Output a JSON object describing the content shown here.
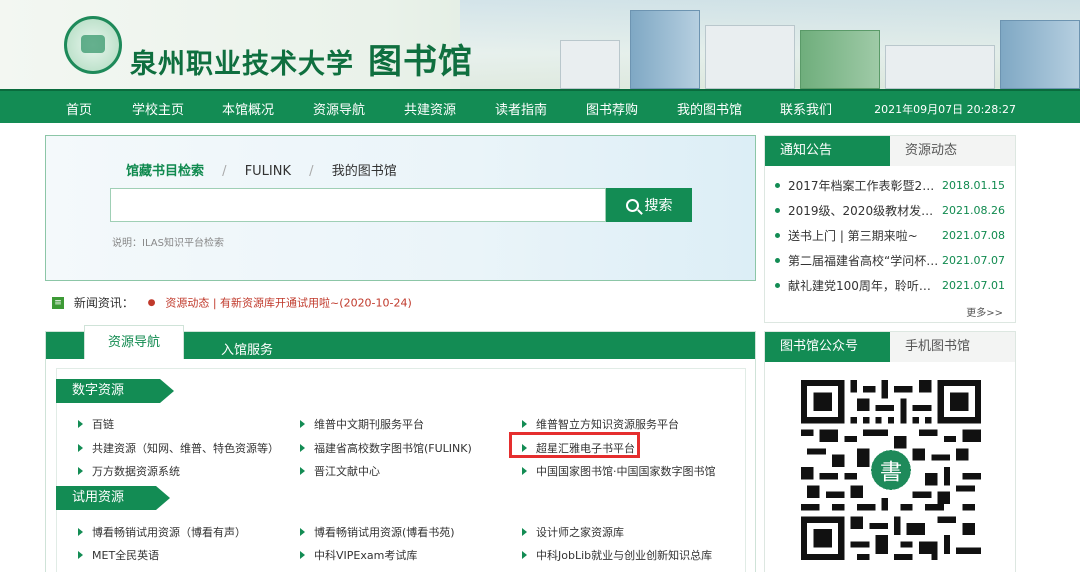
{
  "header": {
    "site_name": "泉州职业技术大学",
    "library_name": "图书馆"
  },
  "nav": {
    "items": [
      "首页",
      "学校主页",
      "本馆概况",
      "资源导航",
      "共建资源",
      "读者指南",
      "图书荐购",
      "我的图书馆",
      "联系我们"
    ],
    "datetime": "2021年09月07日 20:28:27"
  },
  "search": {
    "tabs": [
      "馆藏书目检索",
      "FULINK",
      "我的图书馆"
    ],
    "input_value": "",
    "button_label": "搜索",
    "note": "说明：ILAS知识平台检索"
  },
  "news": {
    "label": "新闻资讯：",
    "item": "资源动态 | 有新资源库开通试用啦~(2020-10-24)"
  },
  "resources": {
    "tabs": [
      "资源导航",
      "入馆服务"
    ],
    "sections": [
      {
        "title": "数字资源",
        "items": [
          "百链",
          "维普中文期刊服务平台",
          "维普智立方知识资源服务平台",
          "共建资源（知网、维普、特色资源等）",
          "福建省高校数字图书馆(FULINK)",
          "超星汇雅电子书平台",
          "万方数据资源系统",
          "晋江文献中心",
          "中国国家图书馆·中国国家数字图书馆"
        ]
      },
      {
        "title": "试用资源",
        "items": [
          "博看畅销试用资源（博看有声）",
          "博看畅销试用资源(博看书苑)",
          "设计师之家资源库",
          "MET全民英语",
          "中科VIPExam考试库",
          "中科JobLib就业与创业创新知识总库"
        ]
      }
    ]
  },
  "notice": {
    "tabs": [
      "通知公告",
      "资源动态"
    ],
    "items": [
      {
        "title": "2017年档案工作表彰暨201…",
        "date": "2018.01.15"
      },
      {
        "title": "2019级、2020级教材发放…",
        "date": "2021.08.26"
      },
      {
        "title": "送书上门 | 第三期来啦~",
        "date": "2021.07.08"
      },
      {
        "title": "第二届福建省高校“学问杯…",
        "date": "2021.07.07"
      },
      {
        "title": "献礼建党100周年，聆听红…",
        "date": "2021.07.01"
      }
    ],
    "more": "更多>>"
  },
  "wechat": {
    "tabs": [
      "图书馆公众号",
      "手机图书馆"
    ],
    "qr_center": "書"
  }
}
